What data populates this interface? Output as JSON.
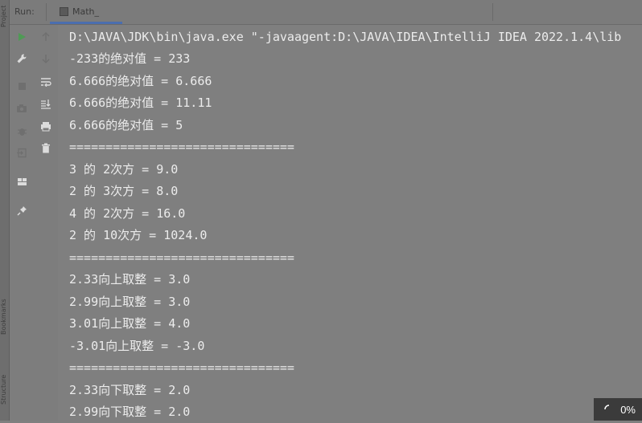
{
  "sidebar": {
    "top_label": "Project",
    "bookmarks_label": "Bookmarks",
    "structure_label": "Structure"
  },
  "header": {
    "run_label": "Run:",
    "tab_name": "Math_"
  },
  "toolbar": {
    "icons": [
      "play-icon",
      "up-arrow-icon",
      "wrench-icon",
      "down-arrow-icon",
      "stop-icon",
      "soft-wrap-icon",
      "camera-icon",
      "scroll-to-end-icon",
      "debug-icon",
      "print-icon",
      "exit-icon",
      "trash-icon",
      "layout-icon",
      "pin-icon"
    ]
  },
  "console": {
    "lines": [
      "D:\\JAVA\\JDK\\bin\\java.exe \"-javaagent:D:\\JAVA\\IDEA\\IntelliJ IDEA 2022.1.4\\lib",
      "-233的绝对值 = 233",
      "6.666的绝对值 = 6.666",
      "6.666的绝对值 = 11.11",
      "6.666的绝对值 = 5",
      "===============================",
      "3 的 2次方 = 9.0",
      "2 的 3次方 = 8.0",
      "4 的 2次方 = 16.0",
      "2 的 10次方 = 1024.0",
      "===============================",
      "2.33向上取整 = 3.0",
      "2.99向上取整 = 3.0",
      "3.01向上取整 = 4.0",
      "-3.01向上取整 = -3.0",
      "===============================",
      "2.33向下取整 = 2.0",
      "2.99向下取整 = 2.0"
    ]
  },
  "status": {
    "progress_text": "0%"
  }
}
